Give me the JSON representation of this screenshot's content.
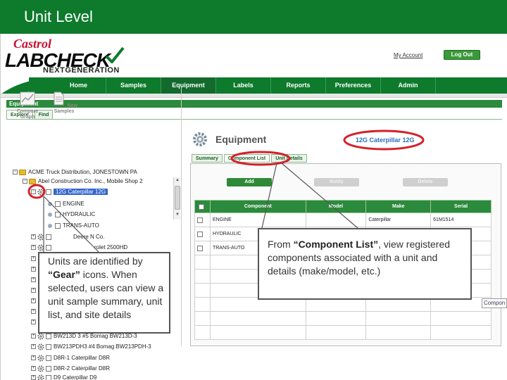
{
  "slide": {
    "title": "Unit Level"
  },
  "brand": {
    "castrol": "Castrol",
    "labcheck": "LABCHECK",
    "next_generation": "NEXTGENERATION"
  },
  "header": {
    "my_account": "My Account",
    "logout": "Log Out"
  },
  "nav": {
    "items": [
      "Home",
      "Samples",
      "Equipment",
      "Labels",
      "Reports",
      "Preferences",
      "Admin"
    ],
    "active": "Equipment"
  },
  "panel": {
    "title": "Equipment",
    "tabs": [
      "Explore",
      "Find"
    ]
  },
  "tools": [
    {
      "label": "Compare Graph",
      "icon": "graph-icon"
    },
    {
      "label": "New Samples",
      "icon": "document-icon"
    }
  ],
  "tree": {
    "root": "ACME Truck Distribution, JONESTOWN PA",
    "branch": "Abel Construction Co. Inc., Mobile Shop 2",
    "selected_unit": "12G Caterpillar 12G",
    "components": [
      "ENGINE",
      "HYDRAULIC",
      "TRANS-AUTO"
    ],
    "units": [
      "Deere N Co.",
      "rolet 2500HD",
      "BW213D 3 #5 Bomag BW213D-3",
      "BW213PDH3 #4 Bomag BW213PDH-3",
      "D8R-1 Caterpillar D8R",
      "D8R-2 Caterpillar D8R",
      "D9 Caterpillar D9"
    ]
  },
  "main": {
    "title": "Equipment",
    "unit_label": "12G Caterpillar 12G",
    "tabs": [
      "Summary",
      "Component List",
      "Unit Details"
    ],
    "active_tab": "Component List",
    "buttons": {
      "add": "Add",
      "notify": "Notify",
      "delete": "Delete"
    },
    "table": {
      "columns": [
        "Component",
        "Model",
        "Make",
        "Serial"
      ],
      "rows": [
        [
          "ENGINE",
          "",
          "Caterpillar",
          "61M1514"
        ],
        [
          "HYDRAULIC",
          "",
          "",
          ""
        ],
        [
          "TRANS-AUTO",
          "",
          "",
          ""
        ]
      ]
    },
    "edge_text": "Compon"
  },
  "callouts": {
    "left": {
      "lead": "Units are identified by ",
      "bold": "“Gear”",
      "rest": " icons. When selected, users can view a unit sample summary, unit list, and site details"
    },
    "right": {
      "lead": "From ",
      "bold": "“Component List”",
      "rest": ", view registered components associated with a unit and details (make/model, etc.)"
    }
  },
  "colors": {
    "brand_green": "#0d7a2c",
    "castrol_red": "#c8102e",
    "highlight_red": "#d4212a",
    "selection_blue": "#3366cc"
  }
}
